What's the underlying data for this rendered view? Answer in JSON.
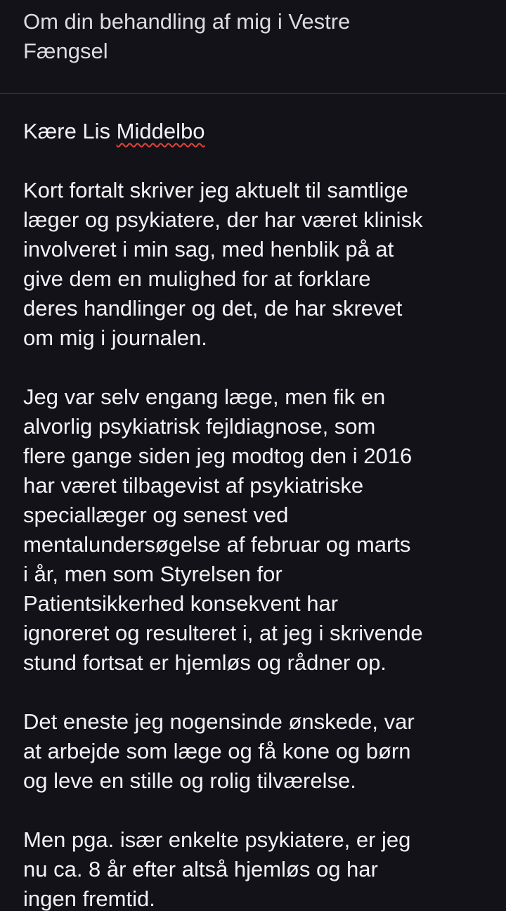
{
  "email": {
    "subject_lines": [
      "Om din behandling af mig i Vestre",
      "Fængsel"
    ],
    "greeting_prefix": "Kære Lis ",
    "greeting_name": "Middelbo",
    "paragraphs": [
      [
        "Kort fortalt skriver jeg aktuelt til samtlige",
        "læger og psykiatere, der har været klinisk",
        "involveret i min sag, med henblik på at",
        "give dem en mulighed for at forklare",
        "deres handlinger og det, de har skrevet",
        "om mig i journalen."
      ],
      [
        "Jeg var selv engang læge, men fik en",
        "alvorlig psykiatrisk fejldiagnose, som",
        "flere gange siden jeg modtog den i 2016",
        "har været tilbagevist af psykiatriske",
        "speciallæger og senest ved",
        "mentalundersøgelse af februar og marts",
        "i år, men som Styrelsen for",
        "Patientsikkerhed konsekvent har",
        "ignoreret og resulteret i, at jeg i skrivende",
        "stund fortsat er hjemløs og rådner op."
      ],
      [
        "Det eneste jeg nogensinde ønskede, var",
        "at arbejde som læge og få kone og børn",
        "og leve en stille og rolig tilværelse."
      ],
      [
        "Men pga. især enkelte psykiatere, er jeg",
        "nu ca. 8 år efter altså hjemløs og har",
        "ingen fremtid."
      ]
    ]
  },
  "colors": {
    "background": "#121218",
    "text": "#f3f3f6",
    "divider": "#4a4a52",
    "spellcheck_underline": "#e0443b"
  }
}
